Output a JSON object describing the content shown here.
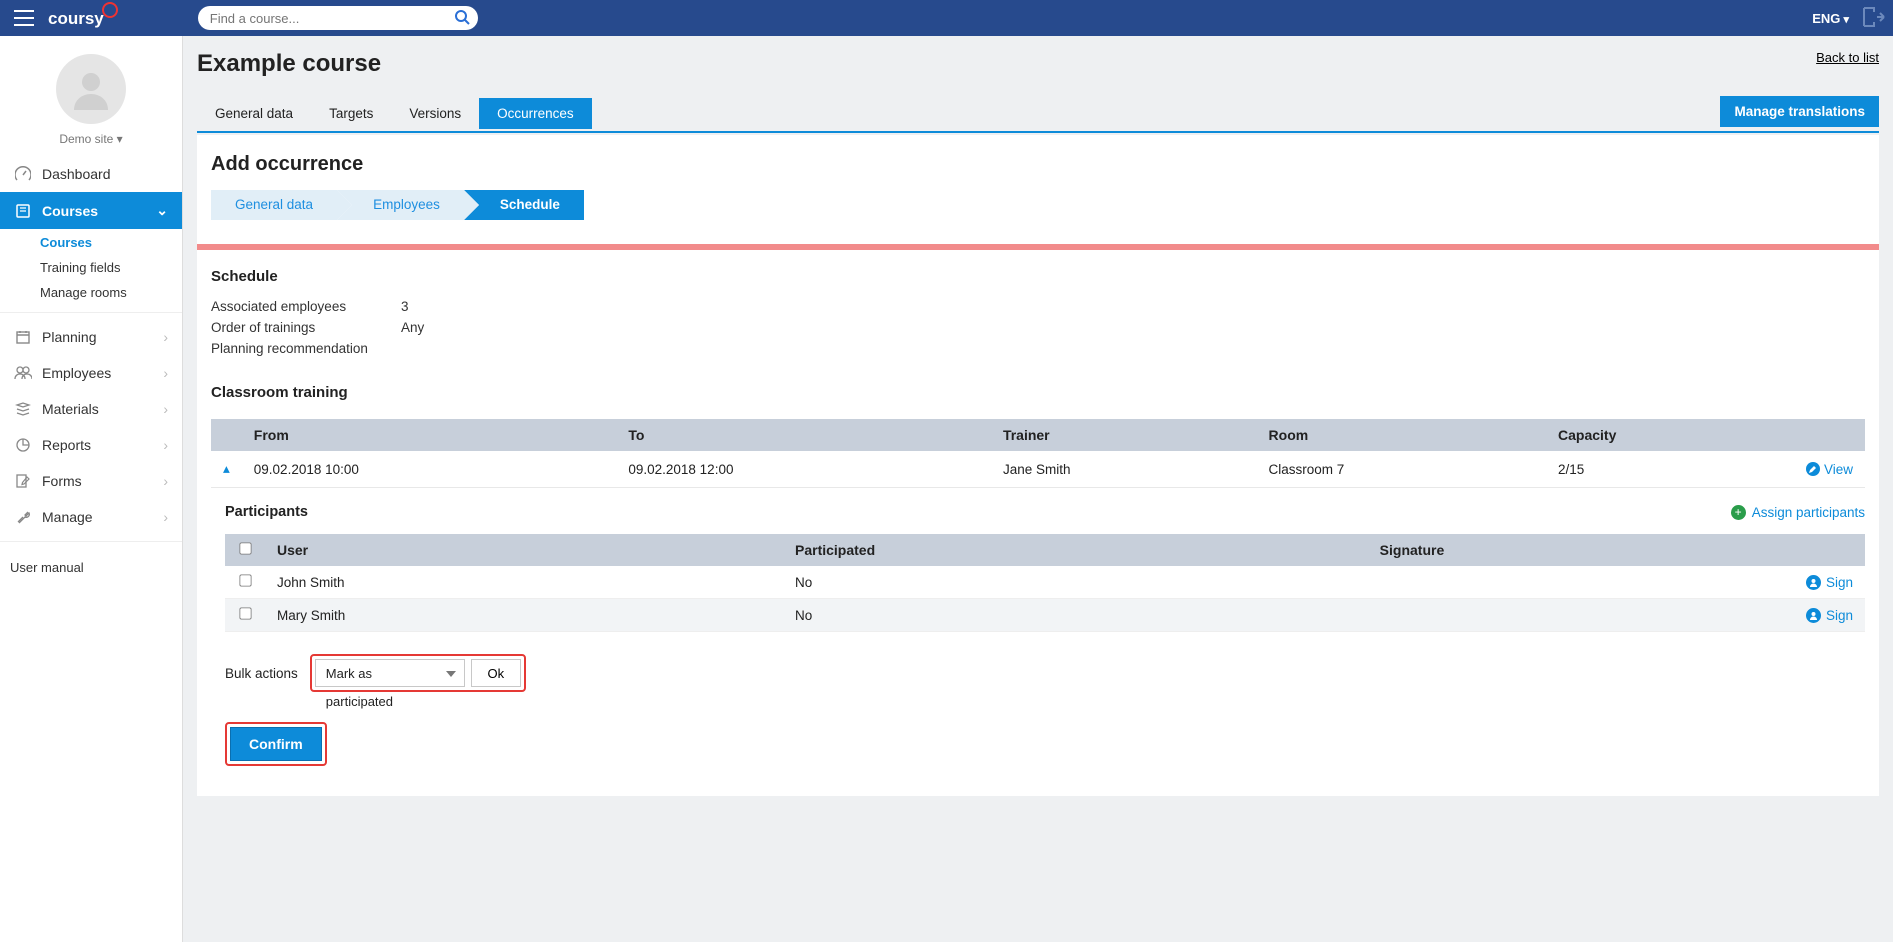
{
  "header": {
    "logo_text": "coursy",
    "search_placeholder": "Find a course...",
    "language": "ENG"
  },
  "sidebar": {
    "site_label": "Demo site ▾",
    "items": [
      {
        "label": "Dashboard",
        "icon": "gauge"
      },
      {
        "label": "Courses",
        "icon": "book",
        "selected": true
      },
      {
        "label": "Planning",
        "icon": "calendar"
      },
      {
        "label": "Employees",
        "icon": "users"
      },
      {
        "label": "Materials",
        "icon": "stack"
      },
      {
        "label": "Reports",
        "icon": "pie"
      },
      {
        "label": "Forms",
        "icon": "edit"
      },
      {
        "label": "Manage",
        "icon": "wrench"
      }
    ],
    "courses_sub": [
      {
        "label": "Courses",
        "active": true
      },
      {
        "label": "Training fields"
      },
      {
        "label": "Manage rooms"
      }
    ],
    "user_manual": "User manual"
  },
  "page": {
    "title": "Example course",
    "back_link": "Back to list",
    "manage_translations": "Manage translations",
    "tabs": [
      {
        "label": "General data"
      },
      {
        "label": "Targets"
      },
      {
        "label": "Versions"
      },
      {
        "label": "Occurrences",
        "active": true
      }
    ],
    "sub_heading": "Add occurrence",
    "wizard": [
      {
        "label": "General data"
      },
      {
        "label": "Employees"
      },
      {
        "label": "Schedule",
        "current": true
      }
    ],
    "schedule": {
      "heading": "Schedule",
      "rows": [
        {
          "label": "Associated employees",
          "value": "3"
        },
        {
          "label": "Order of trainings",
          "value": "Any"
        },
        {
          "label": "Planning recommendation",
          "value": ""
        }
      ]
    },
    "classroom": {
      "heading": "Classroom training",
      "columns": {
        "from": "From",
        "to": "To",
        "trainer": "Trainer",
        "room": "Room",
        "capacity": "Capacity"
      },
      "row": {
        "from": "09.02.2018 10:00",
        "to": "09.02.2018 12:00",
        "trainer": "Jane Smith",
        "room": "Classroom 7",
        "capacity": "2/15"
      },
      "view_label": "View"
    },
    "participants": {
      "heading": "Participants",
      "assign_label": "Assign participants",
      "columns": {
        "user": "User",
        "participated": "Participated",
        "signature": "Signature"
      },
      "rows": [
        {
          "user": "John Smith",
          "participated": "No"
        },
        {
          "user": "Mary Smith",
          "participated": "No"
        }
      ],
      "sign_label": "Sign"
    },
    "bulk": {
      "label": "Bulk actions",
      "select_value": "Mark as participated",
      "ok": "Ok"
    },
    "confirm": "Confirm"
  }
}
